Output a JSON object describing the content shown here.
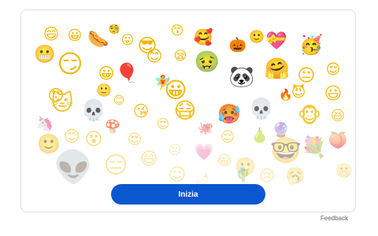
{
  "emoji_board": {
    "items": [
      {
        "name": "nerd-face",
        "glyph": "😄",
        "opacity": 0.9
      },
      {
        "name": "grinning-face",
        "glyph": "😀",
        "opacity": 0.9
      },
      {
        "name": "hot-dog-dog",
        "glyph": "🌭",
        "opacity": 1
      },
      {
        "name": "monocle-face",
        "glyph": "🧐",
        "opacity": 1
      },
      {
        "name": "tongue-face",
        "glyph": "😛",
        "opacity": 1
      },
      {
        "name": "sunglasses-face",
        "glyph": "😎",
        "opacity": 1
      },
      {
        "name": "kiss-face",
        "glyph": "😙",
        "opacity": 1
      },
      {
        "name": "flower-crown-face",
        "glyph": "🥰",
        "opacity": 1
      },
      {
        "name": "pumpkin-face",
        "glyph": "🎃",
        "opacity": 1
      },
      {
        "name": "smile-face",
        "glyph": "🙂",
        "opacity": 1
      },
      {
        "name": "heart-face",
        "glyph": "💝",
        "opacity": 1
      },
      {
        "name": "party-face",
        "glyph": "🥳",
        "opacity": 1
      },
      {
        "name": "grimace-face",
        "glyph": "😬",
        "opacity": 0.9
      },
      {
        "name": "smirk-face",
        "glyph": "😏",
        "opacity": 1
      },
      {
        "name": "small-grin-face",
        "glyph": "😀",
        "opacity": 1
      },
      {
        "name": "balloon-face",
        "glyph": "🎈",
        "opacity": 1
      },
      {
        "name": "smiley-face",
        "glyph": "😊",
        "opacity": 1
      },
      {
        "name": "sleepy-face",
        "glyph": "😪",
        "opacity": 1
      },
      {
        "name": "nauseated-face",
        "glyph": "🤢",
        "opacity": 1
      },
      {
        "name": "panda-face",
        "glyph": "🐼",
        "opacity": 1
      },
      {
        "name": "hug-face",
        "glyph": "🤗",
        "opacity": 1
      },
      {
        "name": "neutral-face",
        "glyph": "😐",
        "opacity": 1
      },
      {
        "name": "relieved-face",
        "glyph": "😌",
        "opacity": 1
      },
      {
        "name": "slight-smile-face",
        "glyph": "🙂",
        "opacity": 0.85
      },
      {
        "name": "wand-face",
        "glyph": "🧚",
        "opacity": 1
      },
      {
        "name": "smile-stack-face",
        "glyph": "😀",
        "opacity": 1
      },
      {
        "name": "fire-face",
        "glyph": "🔥",
        "opacity": 1
      },
      {
        "name": "devil-face",
        "glyph": "😈",
        "opacity": 1
      },
      {
        "name": "big-smile-face",
        "glyph": "😃",
        "opacity": 0.85
      },
      {
        "name": "surprised-face",
        "glyph": "😯",
        "opacity": 1
      },
      {
        "name": "cat-face",
        "glyph": "🐱",
        "opacity": 0.85
      },
      {
        "name": "skull-small",
        "glyph": "💀",
        "opacity": 0.85
      },
      {
        "name": "blush-face",
        "glyph": "😊",
        "opacity": 0.85
      },
      {
        "name": "kissing-heart-face",
        "glyph": "😘",
        "opacity": 0.85
      },
      {
        "name": "mask-face",
        "glyph": "😷",
        "opacity": 0.85
      },
      {
        "name": "flame-face",
        "glyph": "🥵",
        "opacity": 0.85
      },
      {
        "name": "skull-face",
        "glyph": "💀",
        "opacity": 0.8
      },
      {
        "name": "monkey-face",
        "glyph": "🐵",
        "opacity": 0.75
      },
      {
        "name": "laugh-face",
        "glyph": "😆",
        "opacity": 0.7
      },
      {
        "name": "unicorn",
        "glyph": "🦄",
        "opacity": 0.6
      },
      {
        "name": "mushroom",
        "glyph": "🍄",
        "opacity": 0.65
      },
      {
        "name": "heart-eyes-face",
        "glyph": "😍",
        "opacity": 0.6
      },
      {
        "name": "octopus",
        "glyph": "🐙",
        "opacity": 0.5
      },
      {
        "name": "smile-row4-face",
        "glyph": "🙂",
        "opacity": 0.5
      },
      {
        "name": "blush-row4-face",
        "glyph": "😊",
        "opacity": 0.5
      },
      {
        "name": "dizzy-face",
        "glyph": "😵",
        "opacity": 0.5
      },
      {
        "name": "heart-eyes-small-face",
        "glyph": "😍",
        "opacity": 0.5
      },
      {
        "name": "cool-face",
        "glyph": "😌",
        "opacity": 0.5
      },
      {
        "name": "pear-face",
        "glyph": "🍐",
        "opacity": 0.5
      },
      {
        "name": "crystal-ball-face",
        "glyph": "🔮",
        "opacity": 0.45
      },
      {
        "name": "peach-face",
        "glyph": "🍑",
        "opacity": 0.45
      },
      {
        "name": "big-glasses-face",
        "glyph": "🤓",
        "opacity": 0.4
      },
      {
        "name": "bouquet",
        "glyph": "💐",
        "opacity": 0.4
      },
      {
        "name": "alien-face",
        "glyph": "👽",
        "opacity": 0.35
      },
      {
        "name": "squint-face",
        "glyph": "😑",
        "opacity": 0.35
      },
      {
        "name": "happy-face",
        "glyph": "😄",
        "opacity": 0.35
      },
      {
        "name": "blank-face",
        "glyph": "😐",
        "opacity": 0.3
      },
      {
        "name": "heart",
        "glyph": "💗",
        "opacity": 0.3
      },
      {
        "name": "crying-laugh-face",
        "glyph": "😂",
        "opacity": 0.3
      },
      {
        "name": "tear-face",
        "glyph": "🥲",
        "opacity": 0.3
      },
      {
        "name": "wink-face",
        "glyph": "😉",
        "opacity": 0.3
      },
      {
        "name": "pepper",
        "glyph": "🌶",
        "opacity": 0.3
      },
      {
        "name": "cactus-face",
        "glyph": "🌵",
        "opacity": 0.3
      },
      {
        "name": "teary-face",
        "glyph": "😢",
        "opacity": 0.3
      },
      {
        "name": "yawn-face",
        "glyph": "🥱",
        "opacity": 0.3
      },
      {
        "name": "shush-face",
        "glyph": "🤫",
        "opacity": 0.25
      }
    ]
  },
  "start_button": {
    "label": "Inizia"
  },
  "feedback_link": {
    "label": "Feedback"
  },
  "colors": {
    "accent": "#0b57d0",
    "border": "#dcdfe4",
    "muted_text": "#5f6368"
  }
}
